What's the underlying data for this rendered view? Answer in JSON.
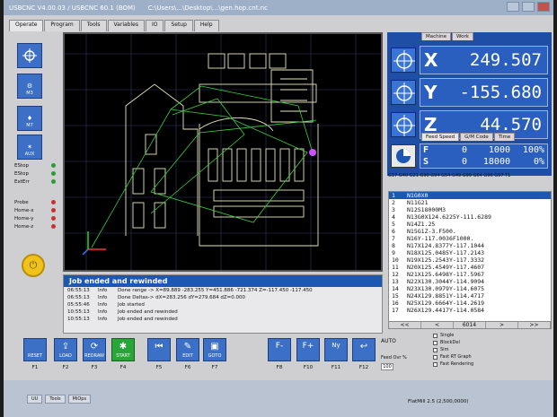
{
  "window": {
    "title": "USBCNC V4.00.03 / USBCNC 60.1 (BOM)",
    "path": "C:\\Users\\...\\Desktop\\...\\gen.hop.cnt.nc"
  },
  "tabs": [
    "Operate",
    "Program",
    "Tools",
    "Variables",
    "IO",
    "Setup",
    "Help"
  ],
  "left_buttons": [
    {
      "name": "home-all-button",
      "label": ""
    },
    {
      "name": "m3-button",
      "label": "M3"
    },
    {
      "name": "m7-button",
      "label": "M7"
    },
    {
      "name": "aux-button",
      "label": "AUX"
    }
  ],
  "leds": [
    {
      "label": "EStop",
      "color": "#2c9a3a"
    },
    {
      "label": "EStop",
      "color": "#2c9a3a"
    },
    {
      "label": "ExtErr",
      "color": "#2c9a3a"
    },
    {
      "label": "Probe",
      "color": "#c93030"
    },
    {
      "label": "Home-x",
      "color": "#c93030"
    },
    {
      "label": "Home-y",
      "color": "#c93030"
    },
    {
      "label": "Home-z",
      "color": "#c93030"
    }
  ],
  "status": {
    "header": "Job ended and rewinded",
    "rows": [
      {
        "time": "06:55:13",
        "level": "Info",
        "msg": "Done range -> X=89.889 -283.255 Y=451.886 -721.374 Z=-117.450 -117.450"
      },
      {
        "time": "06:55:13",
        "level": "Info",
        "msg": "Done Deltas-> dX=283.256 dY=279.684 dZ=0.000"
      },
      {
        "time": "05:55:46",
        "level": "Info",
        "msg": "Job started"
      },
      {
        "time": "10:55:13",
        "level": "Info",
        "msg": "Job ended and rewinded"
      },
      {
        "time": "10:55:13",
        "level": "Info",
        "msg": "Job ended and rewinded"
      }
    ]
  },
  "dro": {
    "tabs": [
      "Machine",
      "Work"
    ],
    "axes": [
      {
        "label": "X",
        "value": "249.507"
      },
      {
        "label": "Y",
        "value": "-155.680"
      },
      {
        "label": "Z",
        "value": "44.570"
      }
    ]
  },
  "feedspeed": {
    "tabs": [
      "Feed Speed",
      "G/M Code",
      "Time"
    ],
    "rows": [
      {
        "label": "F",
        "actual": "0",
        "set": "1000",
        "pct": "100%"
      },
      {
        "label": "S",
        "actual": "0",
        "set": "18000",
        "pct": "0%"
      }
    ]
  },
  "modal_codes": "G17 G40 G21 G90 G94 G54 G49 G99 G64 G96 G97 T1",
  "gcode": {
    "lines": [
      {
        "n": "1",
        "text": "N1G0X0",
        "selected": true
      },
      {
        "n": "2",
        "text": "N11G21",
        "selected": false
      },
      {
        "n": "3",
        "text": "N12S18000M3",
        "selected": false
      },
      {
        "n": "4",
        "text": "N13G0X124.6225Y-111.6289",
        "selected": false
      },
      {
        "n": "5",
        "text": "N14Z1.25",
        "selected": false
      },
      {
        "n": "6",
        "text": "N15G1Z-3.F500.",
        "selected": false
      },
      {
        "n": "7",
        "text": "N16Y-117.0036F1000.",
        "selected": false
      },
      {
        "n": "8",
        "text": "N17X124.8377Y-117.1044",
        "selected": false
      },
      {
        "n": "9",
        "text": "N18X125.0485Y-117.2143",
        "selected": false
      },
      {
        "n": "10",
        "text": "N19X125.2543Y-117.3332",
        "selected": false
      },
      {
        "n": "11",
        "text": "N20X125.4549Y-117.4607",
        "selected": false
      },
      {
        "n": "12",
        "text": "N21X125.6498Y-117.5967",
        "selected": false
      },
      {
        "n": "13",
        "text": "N22X130.3044Y-114.9094",
        "selected": false
      },
      {
        "n": "14",
        "text": "N23X130.0979Y-114.6075",
        "selected": false
      },
      {
        "n": "15",
        "text": "N24X129.8851Y-114.4717",
        "selected": false
      },
      {
        "n": "16",
        "text": "N25X129.6664Y-114.2619",
        "selected": false
      },
      {
        "n": "17",
        "text": "N26X129.4417Y-114.0584",
        "selected": false
      }
    ],
    "nav": [
      "<<",
      "<",
      "6014",
      ">",
      ">>"
    ]
  },
  "bottom_buttons": [
    {
      "name": "reset-button",
      "label": "RESET",
      "fkey": "F1",
      "icon": "",
      "color": "#3c6fc6"
    },
    {
      "name": "load-button",
      "label": "LOAD",
      "fkey": "F2",
      "icon": "⇪",
      "color": "#3c6fc6"
    },
    {
      "name": "redraw-button",
      "label": "REDRAW",
      "fkey": "F3",
      "icon": "⟳",
      "color": "#3c6fc6"
    },
    {
      "name": "start-button",
      "label": "START",
      "fkey": "F4",
      "icon": "✱",
      "color": "#2aa53a"
    },
    {
      "name": "rewind-button",
      "label": "",
      "fkey": "F5",
      "icon": "⏮",
      "color": "#3c6fc6"
    },
    {
      "name": "edit-button",
      "label": "EDIT",
      "fkey": "F6",
      "icon": "✎",
      "color": "#3c6fc6"
    },
    {
      "name": "goto-button",
      "label": "GOTO",
      "fkey": "F7",
      "icon": "▣",
      "color": "#3c6fc6"
    },
    {
      "name": "feed-minus-button",
      "label": "F-",
      "fkey": "F8",
      "icon": "",
      "color": "#3c6fc6"
    },
    {
      "name": "feed-plus-button",
      "label": "F+",
      "fkey": "F10",
      "icon": "",
      "color": "#3c6fc6"
    },
    {
      "name": "ny-button",
      "label": "Ny",
      "fkey": "F11",
      "icon": "",
      "color": "#3c6fc6"
    },
    {
      "name": "return-button",
      "label": "",
      "fkey": "F12",
      "icon": "↩",
      "color": "#3c6fc6"
    }
  ],
  "auto_label": "AUTO",
  "feed_override_label": "Feed Ovr %",
  "feed_override_value": "100",
  "options": [
    "Single",
    "BlockDel",
    "Sim",
    "Fast RT Graph",
    "Fast Rendering"
  ],
  "taskbar": {
    "tasks": [
      "UU",
      "Tools",
      "MiOps"
    ],
    "status": "FlatMill 2.5 (2,500,0000)"
  }
}
